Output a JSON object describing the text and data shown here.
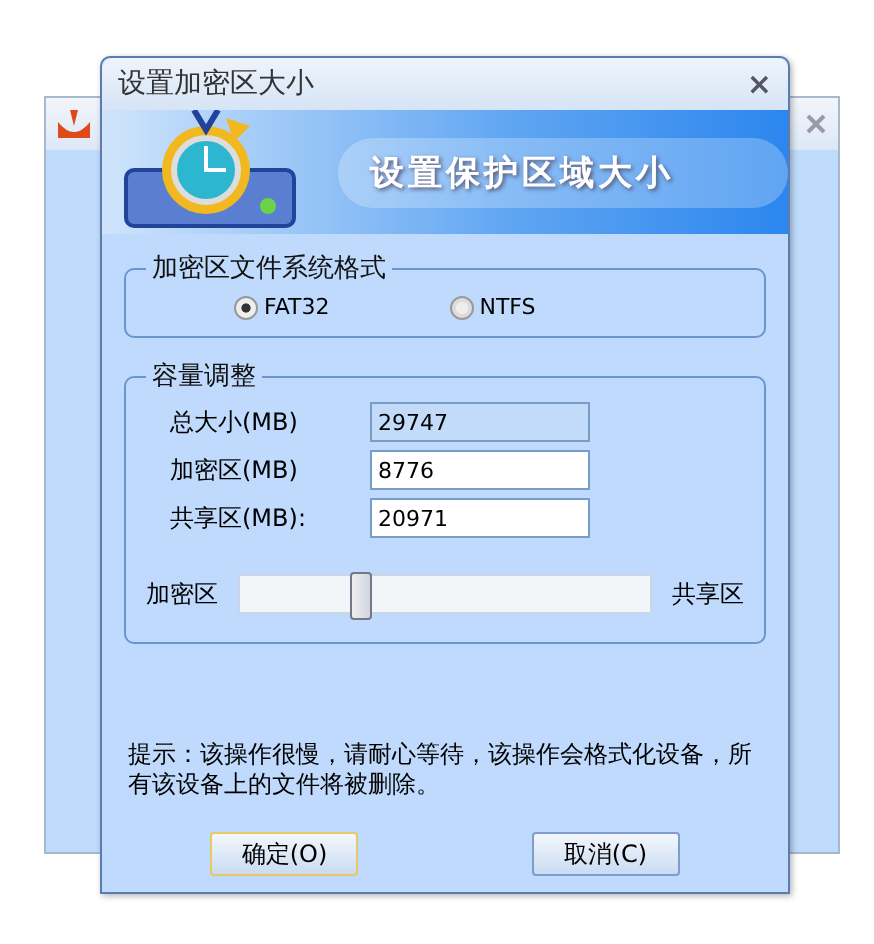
{
  "dialog": {
    "title": "设置加密区大小",
    "close": "×",
    "banner": "设置保护区域大小",
    "format_group": {
      "title": "加密区文件系统格式",
      "options": [
        {
          "label": "FAT32",
          "selected": true
        },
        {
          "label": "NTFS",
          "selected": false
        }
      ]
    },
    "capacity_group": {
      "title": "容量调整",
      "fields": [
        {
          "label": "总大小(MB)",
          "value": "29747",
          "disabled": true
        },
        {
          "label": "加密区(MB)",
          "value": "8776",
          "disabled": false
        },
        {
          "label": "共享区(MB):",
          "value": "20971",
          "disabled": false
        }
      ],
      "slider": {
        "left_label": "加密区",
        "right_label": "共享区",
        "level": 0.295
      }
    },
    "hint": "提示：该操作很慢，请耐心等待，该操作会格式化设备，所有该设备上的文件将被删除。",
    "buttons": [
      {
        "label": "确定(O)",
        "selected": true
      },
      {
        "label": "取消(C)",
        "selected": false
      }
    ]
  }
}
